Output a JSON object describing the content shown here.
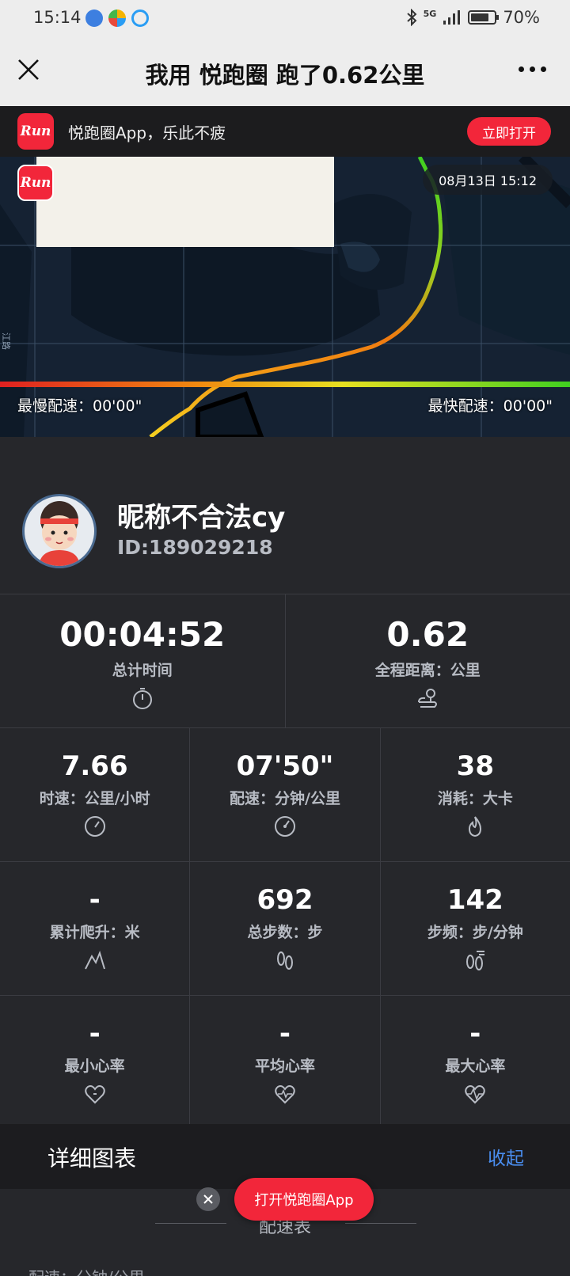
{
  "status_bar": {
    "time": "15:14",
    "signal": "5G",
    "battery": "70%"
  },
  "nav": {
    "title": "我用 悦跑圈 跑了0.62公里"
  },
  "app_banner": {
    "logo_text": "Run",
    "text": "悦跑圈App，乐此不疲",
    "open_label": "立即打开"
  },
  "map": {
    "logo_text": "Run",
    "datetime": "08月13日 15:12",
    "slowest_pace": "最慢配速：00'00\"",
    "fastest_pace": "最快配速：00'00\"",
    "road_label": "江路"
  },
  "profile": {
    "name": "昵称不合法cy",
    "id": "ID:189029218"
  },
  "summary": [
    {
      "value": "00:04:52",
      "label": "总计时间",
      "icon": "stopwatch-icon"
    },
    {
      "value": "0.62",
      "label": "全程距离：公里",
      "icon": "route-icon"
    }
  ],
  "stats": [
    {
      "value": "7.66",
      "label": "时速：公里/小时",
      "icon": "speedometer-icon"
    },
    {
      "value": "07'50\"",
      "label": "配速：分钟/公里",
      "icon": "pace-gauge-icon"
    },
    {
      "value": "38",
      "label": "消耗：大卡",
      "icon": "flame-icon"
    },
    {
      "value": "-",
      "label": "累计爬升：米",
      "icon": "mountain-icon"
    },
    {
      "value": "692",
      "label": "总步数：步",
      "icon": "footprints-icon"
    },
    {
      "value": "142",
      "label": "步频：步/分钟",
      "icon": "cadence-icon"
    },
    {
      "value": "-",
      "label": "最小心率",
      "icon": "heart-min-icon"
    },
    {
      "value": "-",
      "label": "平均心率",
      "icon": "heart-avg-icon"
    },
    {
      "value": "-",
      "label": "最大心率",
      "icon": "heart-max-icon"
    }
  ],
  "detail_sheet": {
    "title": "详细图表",
    "collapse_label": "收起",
    "sub_tab": "配速表",
    "axis_label": "配速：分钟/公里"
  },
  "floating": {
    "open_app_label": "打开悦跑圈App"
  },
  "colors": {
    "accent_red": "#f2263a",
    "link_blue": "#4a8ef0",
    "panel_dark": "#26272b"
  }
}
